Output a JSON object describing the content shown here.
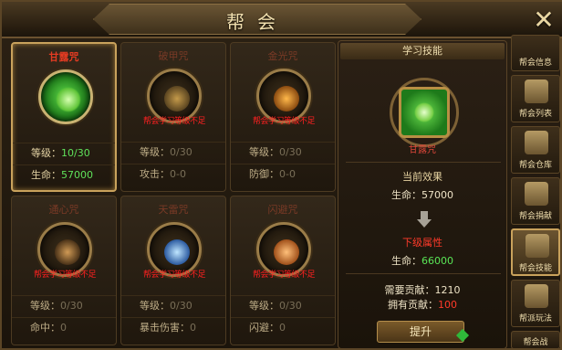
{
  "window": {
    "title": "帮会",
    "close_glyph": "✕"
  },
  "skills": [
    {
      "name": "甘露咒",
      "orb_color": "#2fa326",
      "state": "active",
      "warn": "",
      "stat1_label": "等级：",
      "stat1_value": "10/30",
      "stat2_label": "生命：",
      "stat2_value": "57000"
    },
    {
      "name": "破甲咒",
      "orb_color": "#5a4a30",
      "state": "locked",
      "warn": "帮会学习等级不足",
      "stat1_label": "等级：",
      "stat1_value": "0/30",
      "stat2_label": "攻击：",
      "stat2_value": "0-0"
    },
    {
      "name": "金光咒",
      "orb_color": "#6a4a1e",
      "state": "locked",
      "warn": "帮会学习等级不足",
      "stat1_label": "等级：",
      "stat1_value": "0/30",
      "stat2_label": "防御：",
      "stat2_value": "0-0"
    },
    {
      "name": "通心咒",
      "orb_color": "#4e3a24",
      "state": "locked",
      "warn": "帮会学习等级不足",
      "stat1_label": "等级：",
      "stat1_value": "0/30",
      "stat2_label": "命中：",
      "stat2_value": "0"
    },
    {
      "name": "天雷咒",
      "orb_color": "#2b4a7a",
      "state": "locked",
      "warn": "帮会学习等级不足",
      "stat1_label": "等级：",
      "stat1_value": "0/30",
      "stat2_label": "暴击伤害：",
      "stat2_value": "0"
    },
    {
      "name": "闪避咒",
      "orb_color": "#7a4a1e",
      "state": "locked",
      "warn": "帮会学习等级不足",
      "stat1_label": "等级：",
      "stat1_value": "0/30",
      "stat2_label": "闪避：",
      "stat2_value": "0"
    }
  ],
  "detail": {
    "header": "学习技能",
    "skill_name": "甘露咒",
    "current_effect_title": "当前效果",
    "current_effect_label": "生命：",
    "current_effect_value": "57000",
    "next_level_title": "下级属性",
    "next_level_label": "生命：",
    "next_level_value": "66000",
    "required_label": "需要贡献：",
    "required_value": "1210",
    "owned_label": "拥有贡献：",
    "owned_value": "100",
    "upgrade_label": "提升"
  },
  "sidebar": [
    {
      "label": "帮会信息",
      "icon": "guild-info-icon",
      "active": false
    },
    {
      "label": "帮会列表",
      "icon": "scroll-icon",
      "active": false
    },
    {
      "label": "帮会仓库",
      "icon": "warehouse-icon",
      "active": false
    },
    {
      "label": "帮会捐献",
      "icon": "donate-icon",
      "active": false
    },
    {
      "label": "帮会技能",
      "icon": "skill-book-icon",
      "active": true
    },
    {
      "label": "帮派玩法",
      "icon": "gameplay-icon",
      "active": false
    },
    {
      "label": "帮会战",
      "icon": "battle-icon",
      "active": false
    }
  ]
}
